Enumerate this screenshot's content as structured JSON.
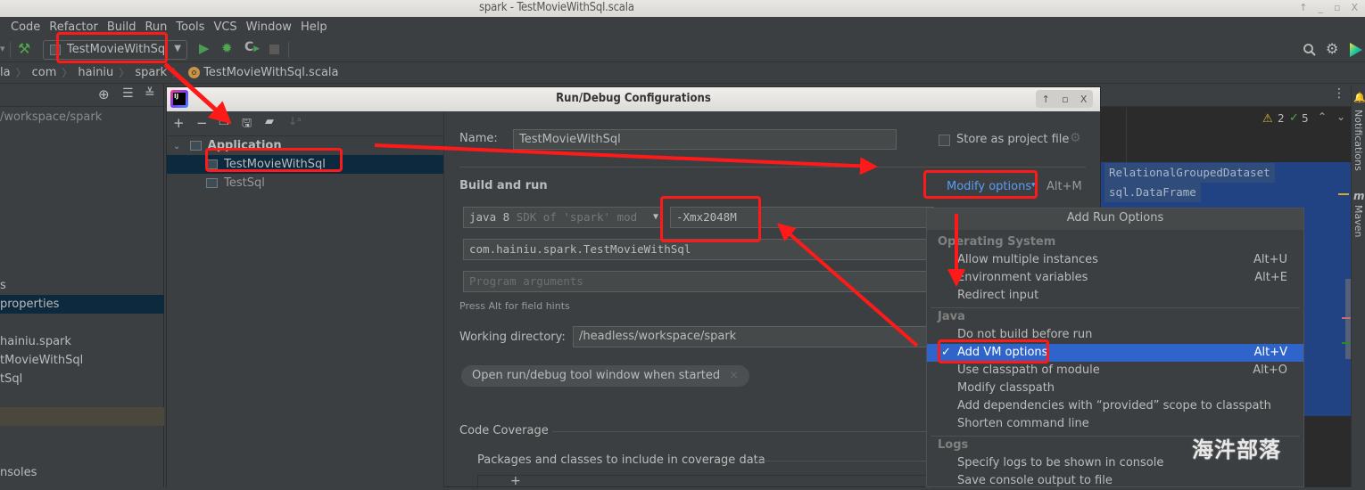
{
  "os_window": {
    "title": "spark - TestMovieWithSql.scala",
    "controls": [
      "↑",
      "_",
      "▫",
      "X"
    ]
  },
  "menubar": {
    "items": [
      {
        "label": "Code",
        "mnemonic": "C"
      },
      {
        "label": "Refactor",
        "mnemonic": "R"
      },
      {
        "label": "Build",
        "mnemonic": "B"
      },
      {
        "label": "Run",
        "mnemonic": "u"
      },
      {
        "label": "Tools",
        "mnemonic": "T"
      },
      {
        "label": "VCS",
        "mnemonic": "S"
      },
      {
        "label": "Window",
        "mnemonic": "W"
      },
      {
        "label": "Help",
        "mnemonic": "H"
      }
    ]
  },
  "toolbar": {
    "run_config": "TestMovieWithSql",
    "icons": [
      "build-hammer-icon",
      "run-icon",
      "debug-icon",
      "coverage-icon",
      "stop-icon"
    ],
    "right_icons": [
      "search-icon",
      "gear-icon",
      "jetbrains-logo-icon"
    ]
  },
  "breadcrumb": {
    "items": [
      "la",
      "com",
      "hainiu",
      "spark",
      "TestMovieWithSql.scala"
    ]
  },
  "project_panel": {
    "path": "/workspace/spark",
    "rows": [
      "s",
      "properties",
      "hainiu.spark",
      "tMovieWithSql",
      "tSql",
      "",
      "nsoles"
    ]
  },
  "editor": {
    "warnings": "2",
    "ok_count": "5",
    "code_lines": [
      "RelationalGroupedDataset",
      "sql.DataFrame"
    ],
    "side_tabs": [
      "Notifications",
      "Maven"
    ]
  },
  "dialog": {
    "title": "Run/Debug Configurations",
    "tree": {
      "group": "Application",
      "items": [
        "TestMovieWithSql",
        "TestSql"
      ],
      "selected": "TestMovieWithSql"
    },
    "name_label": "Name:",
    "name_value": "TestMovieWithSql",
    "store_as_project_file": "Store as project file",
    "store_checked": false,
    "section_build_run": "Build and run",
    "modify_options": "Modify options",
    "modify_shortcut": "Alt+M",
    "jdk": {
      "main": "java 8",
      "hint": "SDK of 'spark' mod"
    },
    "vm_options": "-Xmx2048M",
    "main_class": "com.hainiu.spark.TestMovieWithSql",
    "program_args_placeholder": "Program arguments",
    "field_hint": "Press Alt for field hints",
    "working_dir_label": "Working directory:",
    "working_dir_value": "/headless/workspace/spark",
    "chip": "Open run/debug tool window when started",
    "code_coverage": "Code Coverage",
    "coverage_packages": "Packages and classes to include in coverage data"
  },
  "popup": {
    "title": "Add Run Options",
    "groups": [
      {
        "name": "Operating System",
        "items": [
          {
            "label": "Allow multiple instances",
            "shortcut": "Alt+U"
          },
          {
            "label": "Environment variables",
            "shortcut": "Alt+E"
          },
          {
            "label": "Redirect input",
            "shortcut": ""
          }
        ]
      },
      {
        "name": "Java",
        "items": [
          {
            "label": "Do not build before run",
            "shortcut": ""
          },
          {
            "label": "Add VM options",
            "shortcut": "Alt+V",
            "checked": true,
            "selected": true
          },
          {
            "label": "Use classpath of module",
            "shortcut": "Alt+O"
          },
          {
            "label": "Modify classpath",
            "shortcut": ""
          },
          {
            "label": "Add dependencies with “provided” scope to classpath",
            "shortcut": ""
          },
          {
            "label": "Shorten command line",
            "shortcut": ""
          }
        ]
      },
      {
        "name": "Logs",
        "items": [
          {
            "label": "Specify logs to be shown in console",
            "shortcut": ""
          },
          {
            "label": "Save console output to file",
            "shortcut": ""
          }
        ]
      }
    ]
  },
  "watermark": "海汼部落",
  "colors": {
    "annotation_red": "#ff1a1a",
    "selection_blue": "#2f65ca",
    "link_blue": "#589df6"
  }
}
